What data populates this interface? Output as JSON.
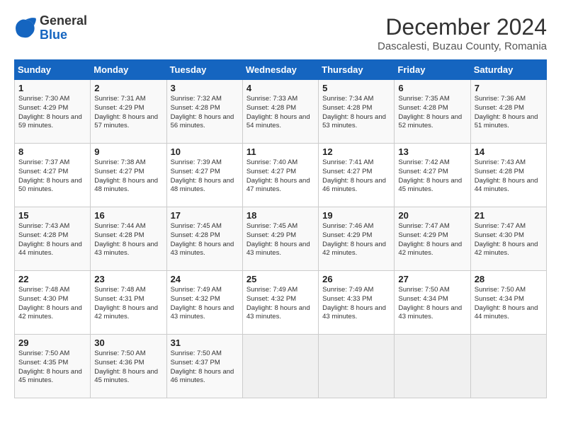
{
  "header": {
    "logo_general": "General",
    "logo_blue": "Blue",
    "month": "December 2024",
    "location": "Dascalesti, Buzau County, Romania"
  },
  "weekdays": [
    "Sunday",
    "Monday",
    "Tuesday",
    "Wednesday",
    "Thursday",
    "Friday",
    "Saturday"
  ],
  "weeks": [
    [
      {
        "day": "1",
        "sunrise": "7:30 AM",
        "sunset": "4:29 PM",
        "daylight": "8 hours and 59 minutes."
      },
      {
        "day": "2",
        "sunrise": "7:31 AM",
        "sunset": "4:29 PM",
        "daylight": "8 hours and 57 minutes."
      },
      {
        "day": "3",
        "sunrise": "7:32 AM",
        "sunset": "4:28 PM",
        "daylight": "8 hours and 56 minutes."
      },
      {
        "day": "4",
        "sunrise": "7:33 AM",
        "sunset": "4:28 PM",
        "daylight": "8 hours and 54 minutes."
      },
      {
        "day": "5",
        "sunrise": "7:34 AM",
        "sunset": "4:28 PM",
        "daylight": "8 hours and 53 minutes."
      },
      {
        "day": "6",
        "sunrise": "7:35 AM",
        "sunset": "4:28 PM",
        "daylight": "8 hours and 52 minutes."
      },
      {
        "day": "7",
        "sunrise": "7:36 AM",
        "sunset": "4:28 PM",
        "daylight": "8 hours and 51 minutes."
      }
    ],
    [
      {
        "day": "8",
        "sunrise": "7:37 AM",
        "sunset": "4:27 PM",
        "daylight": "8 hours and 50 minutes."
      },
      {
        "day": "9",
        "sunrise": "7:38 AM",
        "sunset": "4:27 PM",
        "daylight": "8 hours and 48 minutes."
      },
      {
        "day": "10",
        "sunrise": "7:39 AM",
        "sunset": "4:27 PM",
        "daylight": "8 hours and 48 minutes."
      },
      {
        "day": "11",
        "sunrise": "7:40 AM",
        "sunset": "4:27 PM",
        "daylight": "8 hours and 47 minutes."
      },
      {
        "day": "12",
        "sunrise": "7:41 AM",
        "sunset": "4:27 PM",
        "daylight": "8 hours and 46 minutes."
      },
      {
        "day": "13",
        "sunrise": "7:42 AM",
        "sunset": "4:27 PM",
        "daylight": "8 hours and 45 minutes."
      },
      {
        "day": "14",
        "sunrise": "7:43 AM",
        "sunset": "4:28 PM",
        "daylight": "8 hours and 44 minutes."
      }
    ],
    [
      {
        "day": "15",
        "sunrise": "7:43 AM",
        "sunset": "4:28 PM",
        "daylight": "8 hours and 44 minutes."
      },
      {
        "day": "16",
        "sunrise": "7:44 AM",
        "sunset": "4:28 PM",
        "daylight": "8 hours and 43 minutes."
      },
      {
        "day": "17",
        "sunrise": "7:45 AM",
        "sunset": "4:28 PM",
        "daylight": "8 hours and 43 minutes."
      },
      {
        "day": "18",
        "sunrise": "7:45 AM",
        "sunset": "4:29 PM",
        "daylight": "8 hours and 43 minutes."
      },
      {
        "day": "19",
        "sunrise": "7:46 AM",
        "sunset": "4:29 PM",
        "daylight": "8 hours and 42 minutes."
      },
      {
        "day": "20",
        "sunrise": "7:47 AM",
        "sunset": "4:29 PM",
        "daylight": "8 hours and 42 minutes."
      },
      {
        "day": "21",
        "sunrise": "7:47 AM",
        "sunset": "4:30 PM",
        "daylight": "8 hours and 42 minutes."
      }
    ],
    [
      {
        "day": "22",
        "sunrise": "7:48 AM",
        "sunset": "4:30 PM",
        "daylight": "8 hours and 42 minutes."
      },
      {
        "day": "23",
        "sunrise": "7:48 AM",
        "sunset": "4:31 PM",
        "daylight": "8 hours and 42 minutes."
      },
      {
        "day": "24",
        "sunrise": "7:49 AM",
        "sunset": "4:32 PM",
        "daylight": "8 hours and 43 minutes."
      },
      {
        "day": "25",
        "sunrise": "7:49 AM",
        "sunset": "4:32 PM",
        "daylight": "8 hours and 43 minutes."
      },
      {
        "day": "26",
        "sunrise": "7:49 AM",
        "sunset": "4:33 PM",
        "daylight": "8 hours and 43 minutes."
      },
      {
        "day": "27",
        "sunrise": "7:50 AM",
        "sunset": "4:34 PM",
        "daylight": "8 hours and 43 minutes."
      },
      {
        "day": "28",
        "sunrise": "7:50 AM",
        "sunset": "4:34 PM",
        "daylight": "8 hours and 44 minutes."
      }
    ],
    [
      {
        "day": "29",
        "sunrise": "7:50 AM",
        "sunset": "4:35 PM",
        "daylight": "8 hours and 45 minutes."
      },
      {
        "day": "30",
        "sunrise": "7:50 AM",
        "sunset": "4:36 PM",
        "daylight": "8 hours and 45 minutes."
      },
      {
        "day": "31",
        "sunrise": "7:50 AM",
        "sunset": "4:37 PM",
        "daylight": "8 hours and 46 minutes."
      },
      null,
      null,
      null,
      null
    ]
  ]
}
